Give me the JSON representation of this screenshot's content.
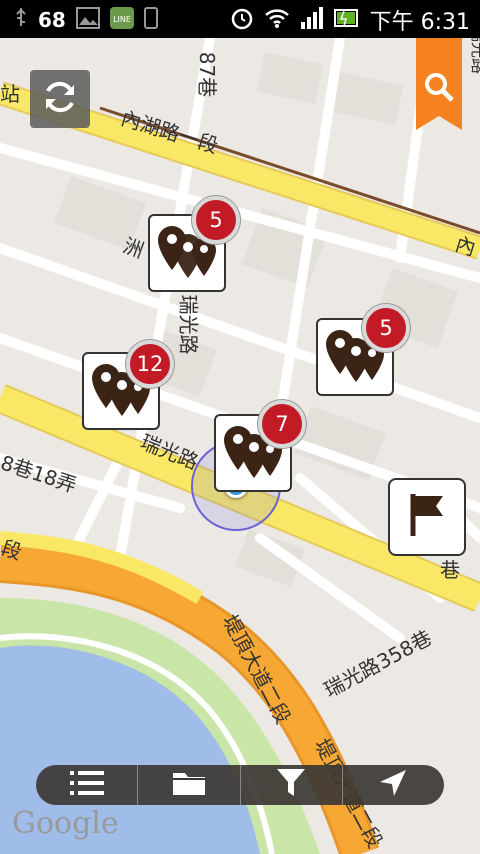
{
  "status_bar": {
    "icons": [
      "usb-icon",
      "battery-percent",
      "image-icon",
      "line-app-icon",
      "phone-icon",
      "alarm-icon",
      "wifi-icon",
      "signal-icon",
      "battery-icon"
    ],
    "battery_level": "68",
    "time": "下午 6:31"
  },
  "map": {
    "street_labels": [
      {
        "key": "neihu1",
        "text": "內湖路一段"
      },
      {
        "key": "neihu_r",
        "text": "內"
      },
      {
        "key": "ruiguang_v",
        "text": "瑞光路"
      },
      {
        "key": "ruiguang_h",
        "text": "瑞光路"
      },
      {
        "key": "zhou",
        "text": "洲"
      },
      {
        "key": "lane8",
        "text": "8巷18弄"
      },
      {
        "key": "lane87",
        "text": "87巷"
      },
      {
        "key": "di_v1",
        "text": "堤頂大道二段"
      },
      {
        "key": "di_v2",
        "text": "堤頂大道二段"
      },
      {
        "key": "rg358",
        "text": "瑞光路358巷"
      },
      {
        "key": "duan",
        "text": "段"
      },
      {
        "key": "xiang",
        "text": "巷"
      },
      {
        "key": "zhan",
        "text": "站"
      },
      {
        "key": "top_right",
        "text": "瑞光路"
      }
    ],
    "clusters": [
      {
        "count": "5"
      },
      {
        "count": "12"
      },
      {
        "count": "5"
      },
      {
        "count": "7"
      }
    ],
    "colors": {
      "land": "#ece9e4",
      "road_major": "#f9e866",
      "road_minor": "#ffffff",
      "park": "#c9e5a7",
      "water": "#9fbde8",
      "highway": "#f7a733",
      "location": "#3796d6"
    }
  },
  "controls": {
    "refresh": "refresh-icon",
    "search": "search-icon",
    "flag": "flag-icon"
  },
  "toolbar": [
    "list-icon",
    "folder-icon",
    "filter-icon",
    "navigate-icon"
  ],
  "attribution": "Google"
}
